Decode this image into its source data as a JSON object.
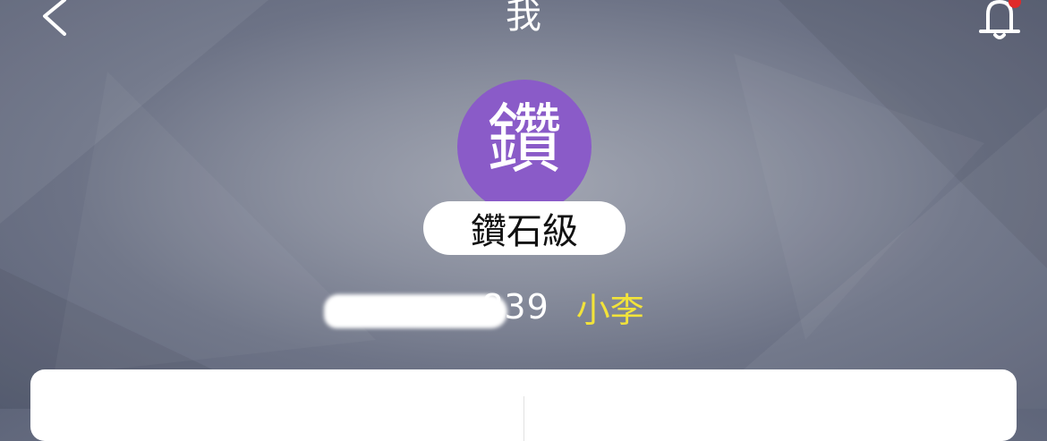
{
  "header": {
    "back_icon": "chevron-left-icon",
    "title": "我",
    "notification_icon": "bell-icon",
    "notification_badge_color": "#e02a2a"
  },
  "profile": {
    "avatar_text": "鑽",
    "avatar_color": "#8a5bc8",
    "level_label": "鑽石級",
    "phone_visible": "839",
    "phone_masked": true,
    "nickname": "小李",
    "nickname_color": "#f2e33a"
  }
}
